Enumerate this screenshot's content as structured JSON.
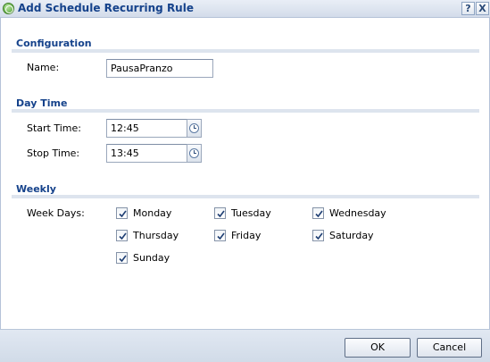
{
  "window": {
    "title": "Add Schedule Recurring Rule",
    "help_label": "?",
    "close_label": "X"
  },
  "configuration": {
    "header": "Configuration",
    "name_label": "Name:",
    "name_value": "PausaPranzo"
  },
  "day_time": {
    "header": "Day Time",
    "start_label": "Start Time:",
    "start_value": "12:45",
    "stop_label": "Stop Time:",
    "stop_value": "13:45"
  },
  "weekly": {
    "header": "Weekly",
    "week_days_label": "Week Days:",
    "days": [
      {
        "label": "Monday",
        "checked": true
      },
      {
        "label": "Tuesday",
        "checked": true
      },
      {
        "label": "Wednesday",
        "checked": true
      },
      {
        "label": "Thursday",
        "checked": true
      },
      {
        "label": "Friday",
        "checked": true
      },
      {
        "label": "Saturday",
        "checked": true
      },
      {
        "label": "Sunday",
        "checked": true
      }
    ]
  },
  "buttons": {
    "ok": "OK",
    "cancel": "Cancel"
  },
  "icons": {
    "title": "add-rule-icon",
    "clock": "clock-icon",
    "check": "checkmark-icon"
  },
  "colors": {
    "section_header": "#15428b",
    "titlebar": "#d3dcea",
    "footer": "#d1dbe8"
  }
}
